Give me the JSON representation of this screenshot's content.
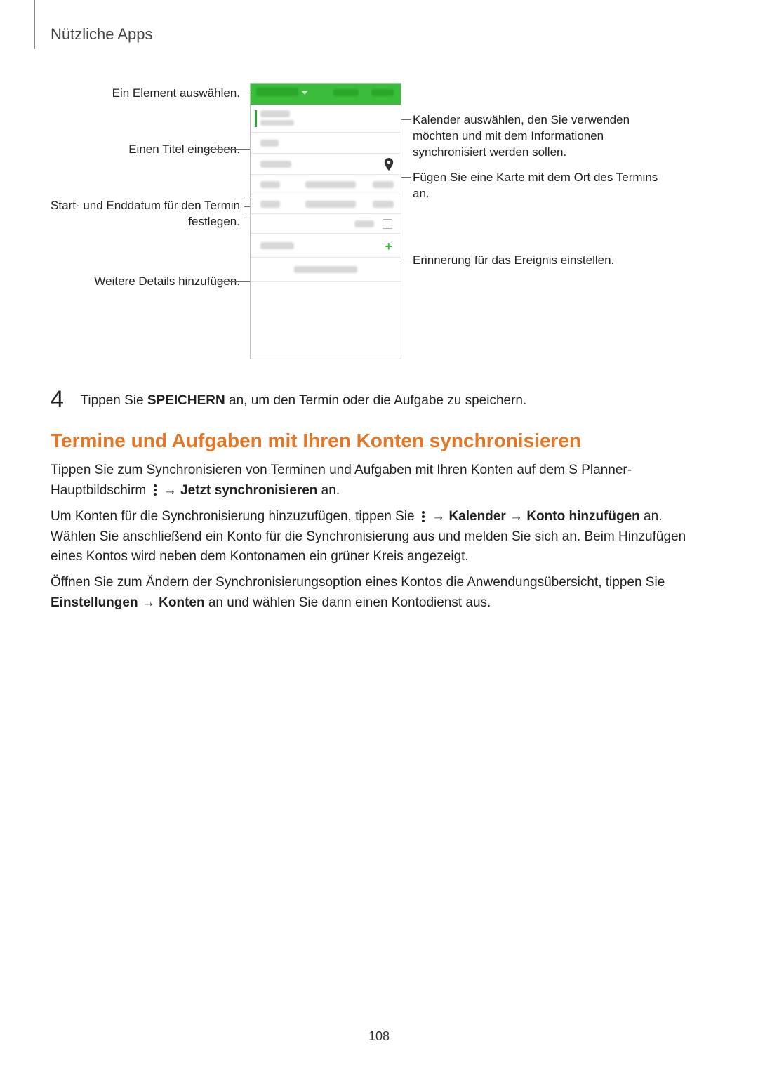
{
  "section_title": "Nützliche Apps",
  "callouts": {
    "select_element": "Ein Element auswählen.",
    "enter_title": "Einen Titel eingeben.",
    "set_dates": "Start- und Enddatum für den Termin festlegen.",
    "add_details": "Weitere Details hinzufügen.",
    "choose_calendar": "Kalender auswählen, den Sie verwenden möchten und mit dem Informationen synchronisiert werden sollen.",
    "add_map": "Fügen Sie eine Karte mit dem Ort des Termins an.",
    "set_reminder": "Erinnerung für das Ereignis einstellen."
  },
  "step4": {
    "num": "4",
    "pre": "Tippen Sie ",
    "bold": "SPEICHERN",
    "post": " an, um den Termin oder die Aufgabe zu speichern."
  },
  "heading": "Termine und Aufgaben mit Ihren Konten synchronisieren",
  "p1": {
    "a": "Tippen Sie zum Synchronisieren von Terminen und Aufgaben mit Ihren Konten auf dem S Planner-Hauptbildschirm ",
    "arrow": " → ",
    "b": "Jetzt synchronisieren",
    "c": " an."
  },
  "p2": {
    "a": "Um Konten für die Synchronisierung hinzuzufügen, tippen Sie ",
    "arrow": " → ",
    "b": "Kalender",
    "c": "Konto hinzufügen",
    "d": " an. Wählen Sie anschließend ein Konto für die Synchronisierung aus und melden Sie sich an. Beim Hinzufügen eines Kontos wird neben dem Kontonamen ein grüner Kreis angezeigt."
  },
  "p3": {
    "a": "Öffnen Sie zum Ändern der Synchronisierungsoption eines Kontos die Anwendungsübersicht, tippen Sie ",
    "b": "Einstellungen",
    "arrow": " → ",
    "c": "Konten",
    "d": " an und wählen Sie dann einen Kontodienst aus."
  },
  "page_number": "108"
}
